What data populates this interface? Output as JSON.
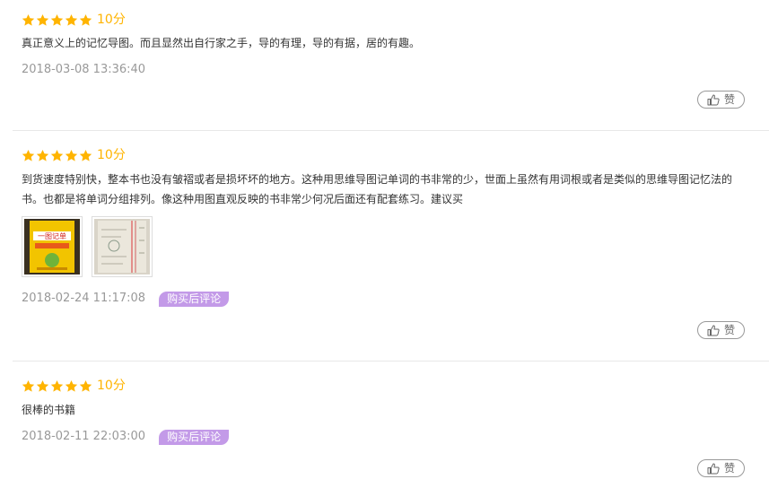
{
  "reviews": [
    {
      "rating": 5,
      "score": "10分",
      "text": "真正意义上的记忆导图。而且显然出自行家之手，导的有理，导的有据，居的有趣。",
      "date": "2018-03-08 13:36:40",
      "badge": "",
      "like_label": "赞"
    },
    {
      "rating": 5,
      "score": "10分",
      "text": "到货速度特别快，整本书也没有皱褶或者是损坏坏的地方。这种用思维导图记单词的书非常的少，世面上虽然有用词根或者是类似的思维导图记忆法的书。也都是将单词分组排列。像这种用图直观反映的书非常少何况后面还有配套练习。建议买",
      "date": "2018-02-24 11:17:08",
      "badge": "购买后评论",
      "like_label": "赞",
      "photos": [
        "book-cover-photo",
        "book-page-photo"
      ]
    },
    {
      "rating": 5,
      "score": "10分",
      "text": "很棒的书籍",
      "date": "2018-02-11 22:03:00",
      "badge": "购买后评论",
      "like_label": "赞"
    }
  ],
  "colors": {
    "star": "#ffb400",
    "badge": "#c39ae8",
    "date": "#999999"
  },
  "photo_cover_text": "一图记单"
}
